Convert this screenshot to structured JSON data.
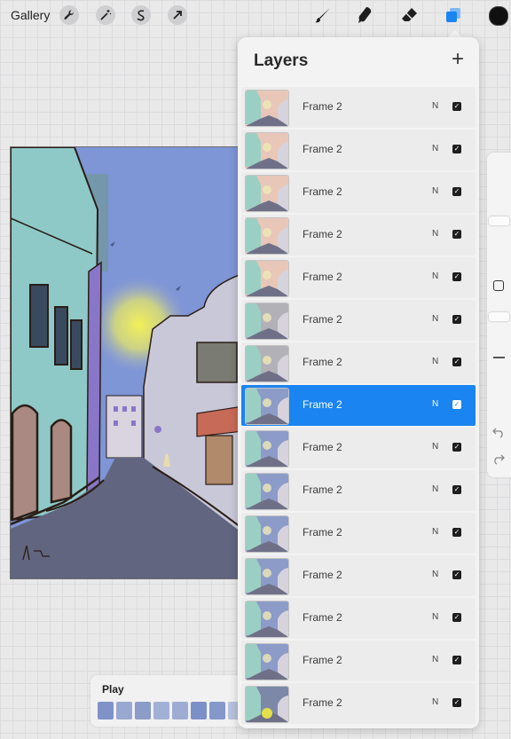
{
  "toolbar": {
    "gallery_label": "Gallery",
    "left_tools": [
      "wrench-icon",
      "magic-wand-icon",
      "selection-icon",
      "transform-arrow-icon"
    ],
    "right_tools": [
      "brush-icon",
      "smudge-icon",
      "eraser-icon",
      "layers-icon"
    ],
    "active_tool": "layers-icon",
    "accent_color": "#1a84f1",
    "current_color": "#101010"
  },
  "layers_panel": {
    "title": "Layers",
    "add_label": "+",
    "layers": [
      {
        "name": "Frame 2",
        "mode": "N",
        "visible": true,
        "selected": false,
        "tone": "warm"
      },
      {
        "name": "Frame 2",
        "mode": "N",
        "visible": true,
        "selected": false,
        "tone": "warm"
      },
      {
        "name": "Frame 2",
        "mode": "N",
        "visible": true,
        "selected": false,
        "tone": "warm"
      },
      {
        "name": "Frame 2",
        "mode": "N",
        "visible": true,
        "selected": false,
        "tone": "warm"
      },
      {
        "name": "Frame 2",
        "mode": "N",
        "visible": true,
        "selected": false,
        "tone": "warm"
      },
      {
        "name": "Frame 2",
        "mode": "N",
        "visible": true,
        "selected": false,
        "tone": "dusk"
      },
      {
        "name": "Frame 2",
        "mode": "N",
        "visible": true,
        "selected": false,
        "tone": "dusk"
      },
      {
        "name": "Frame 2",
        "mode": "N",
        "visible": true,
        "selected": true,
        "tone": "blue"
      },
      {
        "name": "Frame 2",
        "mode": "N",
        "visible": true,
        "selected": false,
        "tone": "blue"
      },
      {
        "name": "Frame 2",
        "mode": "N",
        "visible": true,
        "selected": false,
        "tone": "blue"
      },
      {
        "name": "Frame 2",
        "mode": "N",
        "visible": true,
        "selected": false,
        "tone": "blue"
      },
      {
        "name": "Frame 2",
        "mode": "N",
        "visible": true,
        "selected": false,
        "tone": "blue"
      },
      {
        "name": "Frame 2",
        "mode": "N",
        "visible": true,
        "selected": false,
        "tone": "blue"
      },
      {
        "name": "Frame 2",
        "mode": "N",
        "visible": true,
        "selected": false,
        "tone": "blue"
      },
      {
        "name": "Frame 2",
        "mode": "N",
        "visible": true,
        "selected": false,
        "tone": "night"
      }
    ]
  },
  "side_controls": {
    "modify_icon": "square-icon",
    "undo_icon": "undo-icon",
    "redo_icon": "redo-icon"
  },
  "play": {
    "label": "Play",
    "frame_count": 8
  }
}
